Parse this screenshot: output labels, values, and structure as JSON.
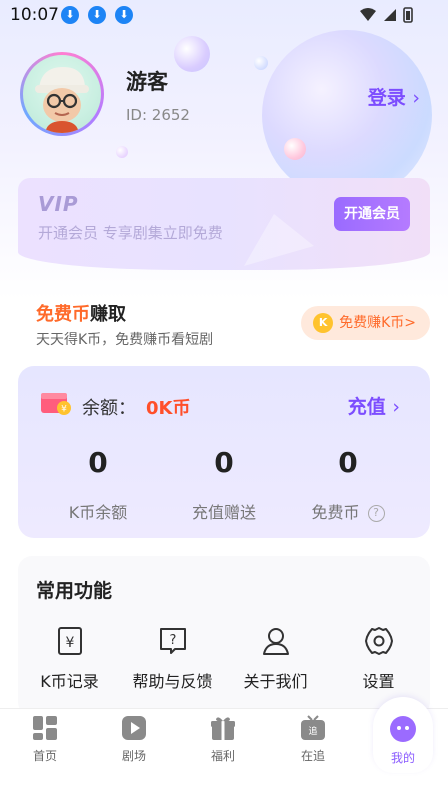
{
  "status_bar": {
    "time": "10:07"
  },
  "profile": {
    "username": "游客",
    "user_id": "ID: 2652",
    "login_label": "登录"
  },
  "vip": {
    "logo": "VIP",
    "description": "开通会员  专享剧集立即免费",
    "button": "开通会员"
  },
  "free_coin": {
    "title_accent": "免费币",
    "title_rest": "赚取",
    "subtitle": "天天得K币，免费赚币看短剧",
    "button": "免费赚K币>",
    "badge": "K"
  },
  "balance": {
    "label": "余额：",
    "value": "0K币",
    "recharge": "充值",
    "stats": [
      {
        "value": "0",
        "label": "K币余额"
      },
      {
        "value": "0",
        "label": "充值赠送"
      },
      {
        "value": "0",
        "label": "免费币"
      }
    ]
  },
  "functions": {
    "title": "常用功能",
    "items": [
      {
        "label": "K币记录",
        "icon": "yen-record-icon"
      },
      {
        "label": "帮助与反馈",
        "icon": "help-icon"
      },
      {
        "label": "关于我们",
        "icon": "user-icon"
      },
      {
        "label": "设置",
        "icon": "gear-icon"
      }
    ]
  },
  "tabs": [
    {
      "label": "首页",
      "icon": "home-grid-icon"
    },
    {
      "label": "剧场",
      "icon": "play-icon"
    },
    {
      "label": "福利",
      "icon": "gift-icon"
    },
    {
      "label": "在追",
      "icon": "tv-follow-icon"
    },
    {
      "label": "我的",
      "icon": "profile-icon",
      "active": true
    }
  ],
  "colors": {
    "accent": "#7c4dff",
    "orange": "#ff6a2a",
    "balance_red": "#ff4f2a"
  }
}
